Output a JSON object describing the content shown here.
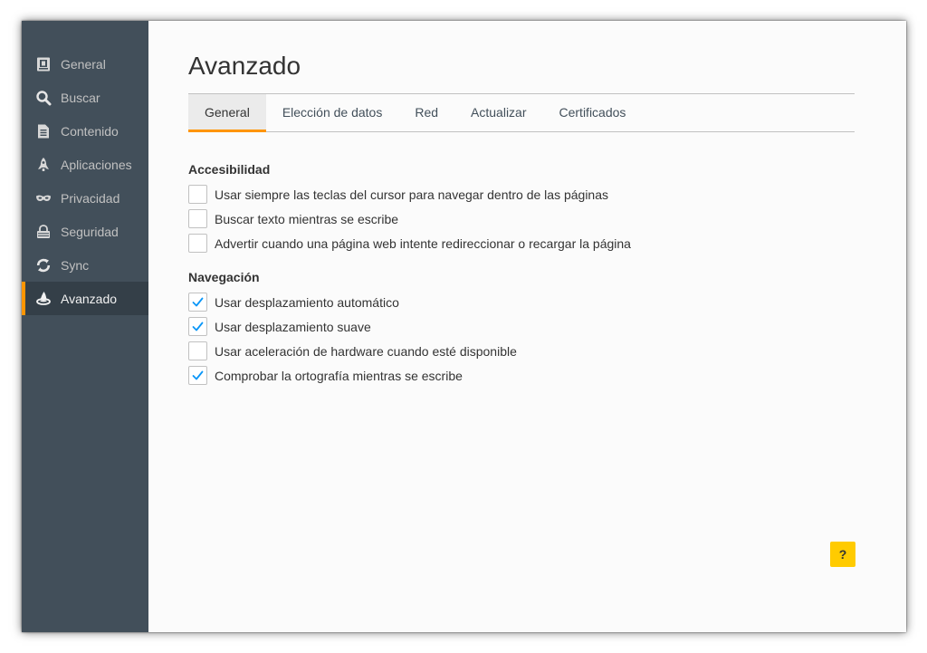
{
  "sidebar": {
    "items": [
      {
        "label": "General",
        "icon": "general-icon"
      },
      {
        "label": "Buscar",
        "icon": "search-icon"
      },
      {
        "label": "Contenido",
        "icon": "document-icon"
      },
      {
        "label": "Aplicaciones",
        "icon": "rocket-icon"
      },
      {
        "label": "Privacidad",
        "icon": "mask-icon"
      },
      {
        "label": "Seguridad",
        "icon": "lock-icon"
      },
      {
        "label": "Sync",
        "icon": "sync-icon"
      },
      {
        "label": "Avanzado",
        "icon": "wizard-hat-icon"
      }
    ],
    "selected_index": 7
  },
  "main": {
    "title": "Avanzado",
    "tabs": [
      {
        "label": "General"
      },
      {
        "label": "Elección de datos"
      },
      {
        "label": "Red"
      },
      {
        "label": "Actualizar"
      },
      {
        "label": "Certificados"
      }
    ],
    "selected_tab": 0,
    "groups": [
      {
        "title": "Accesibilidad",
        "options": [
          {
            "label": "Usar siempre las teclas del cursor para navegar dentro de las páginas",
            "checked": false
          },
          {
            "label": "Buscar texto mientras se escribe",
            "checked": false
          },
          {
            "label": "Advertir cuando una página web intente redireccionar o recargar la página",
            "checked": false
          }
        ]
      },
      {
        "title": "Navegación",
        "options": [
          {
            "label": "Usar desplazamiento automático",
            "checked": true
          },
          {
            "label": "Usar desplazamiento suave",
            "checked": true
          },
          {
            "label": "Usar aceleración de hardware cuando esté disponible",
            "checked": false
          },
          {
            "label": "Comprobar la ortografía mientras se escribe",
            "checked": true
          }
        ]
      }
    ],
    "help_label": "?"
  },
  "colors": {
    "sidebar_bg": "#424f5a",
    "sidebar_selected_bg": "#343f48",
    "accent": "#ff9500",
    "check": "#0996f8",
    "help_bg": "#ffcb00"
  }
}
